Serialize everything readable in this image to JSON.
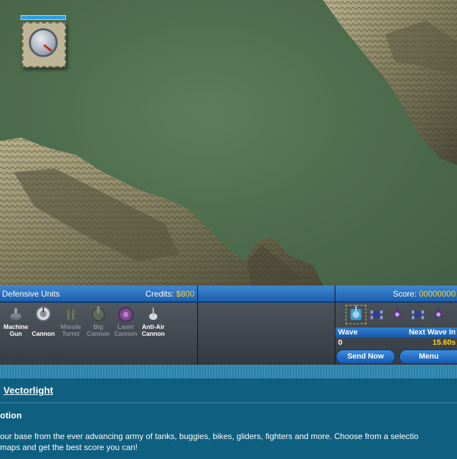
{
  "panel": {
    "units_title": "Defensive Units",
    "credits_label": "Credits:",
    "credits_value": "$800",
    "score_label": "Score:",
    "score_value": "00000000",
    "units": [
      {
        "line1": "Machine",
        "line2": "Gun",
        "icon": "machine-gun-icon",
        "available": true
      },
      {
        "line1": "",
        "line2": "Cannon",
        "icon": "cannon-icon",
        "available": true
      },
      {
        "line1": "Missile",
        "line2": "Turret",
        "icon": "missile-turret-icon",
        "available": false
      },
      {
        "line1": "Big",
        "line2": "Cannon",
        "icon": "big-cannon-icon",
        "available": false
      },
      {
        "line1": "Laser",
        "line2": "Cannon",
        "icon": "laser-cannon-icon",
        "available": false
      },
      {
        "line1": "Anti-Air",
        "line2": "Cannon",
        "icon": "anti-air-cannon-icon",
        "available": true
      }
    ],
    "wave_label": "Wave",
    "next_wave_label": "Next Wave In",
    "wave_value": "0",
    "next_wave_value": "15.60s",
    "send_now_label": "Send Now",
    "menu_label": "Menu"
  },
  "info": {
    "link_text": "Vectorlight",
    "heading": "otion",
    "description_line1": "our base from the ever advancing army of tanks, buggies, bikes, gliders, fighters and more.  Choose from a selectio",
    "description_line2": "maps and get the best score you can!"
  },
  "colors": {
    "credits_value": "#ffd21f",
    "next_wave_value": "#ffd21f",
    "panel_header": "#2a72c2",
    "info_bg": "#0f5f80"
  }
}
